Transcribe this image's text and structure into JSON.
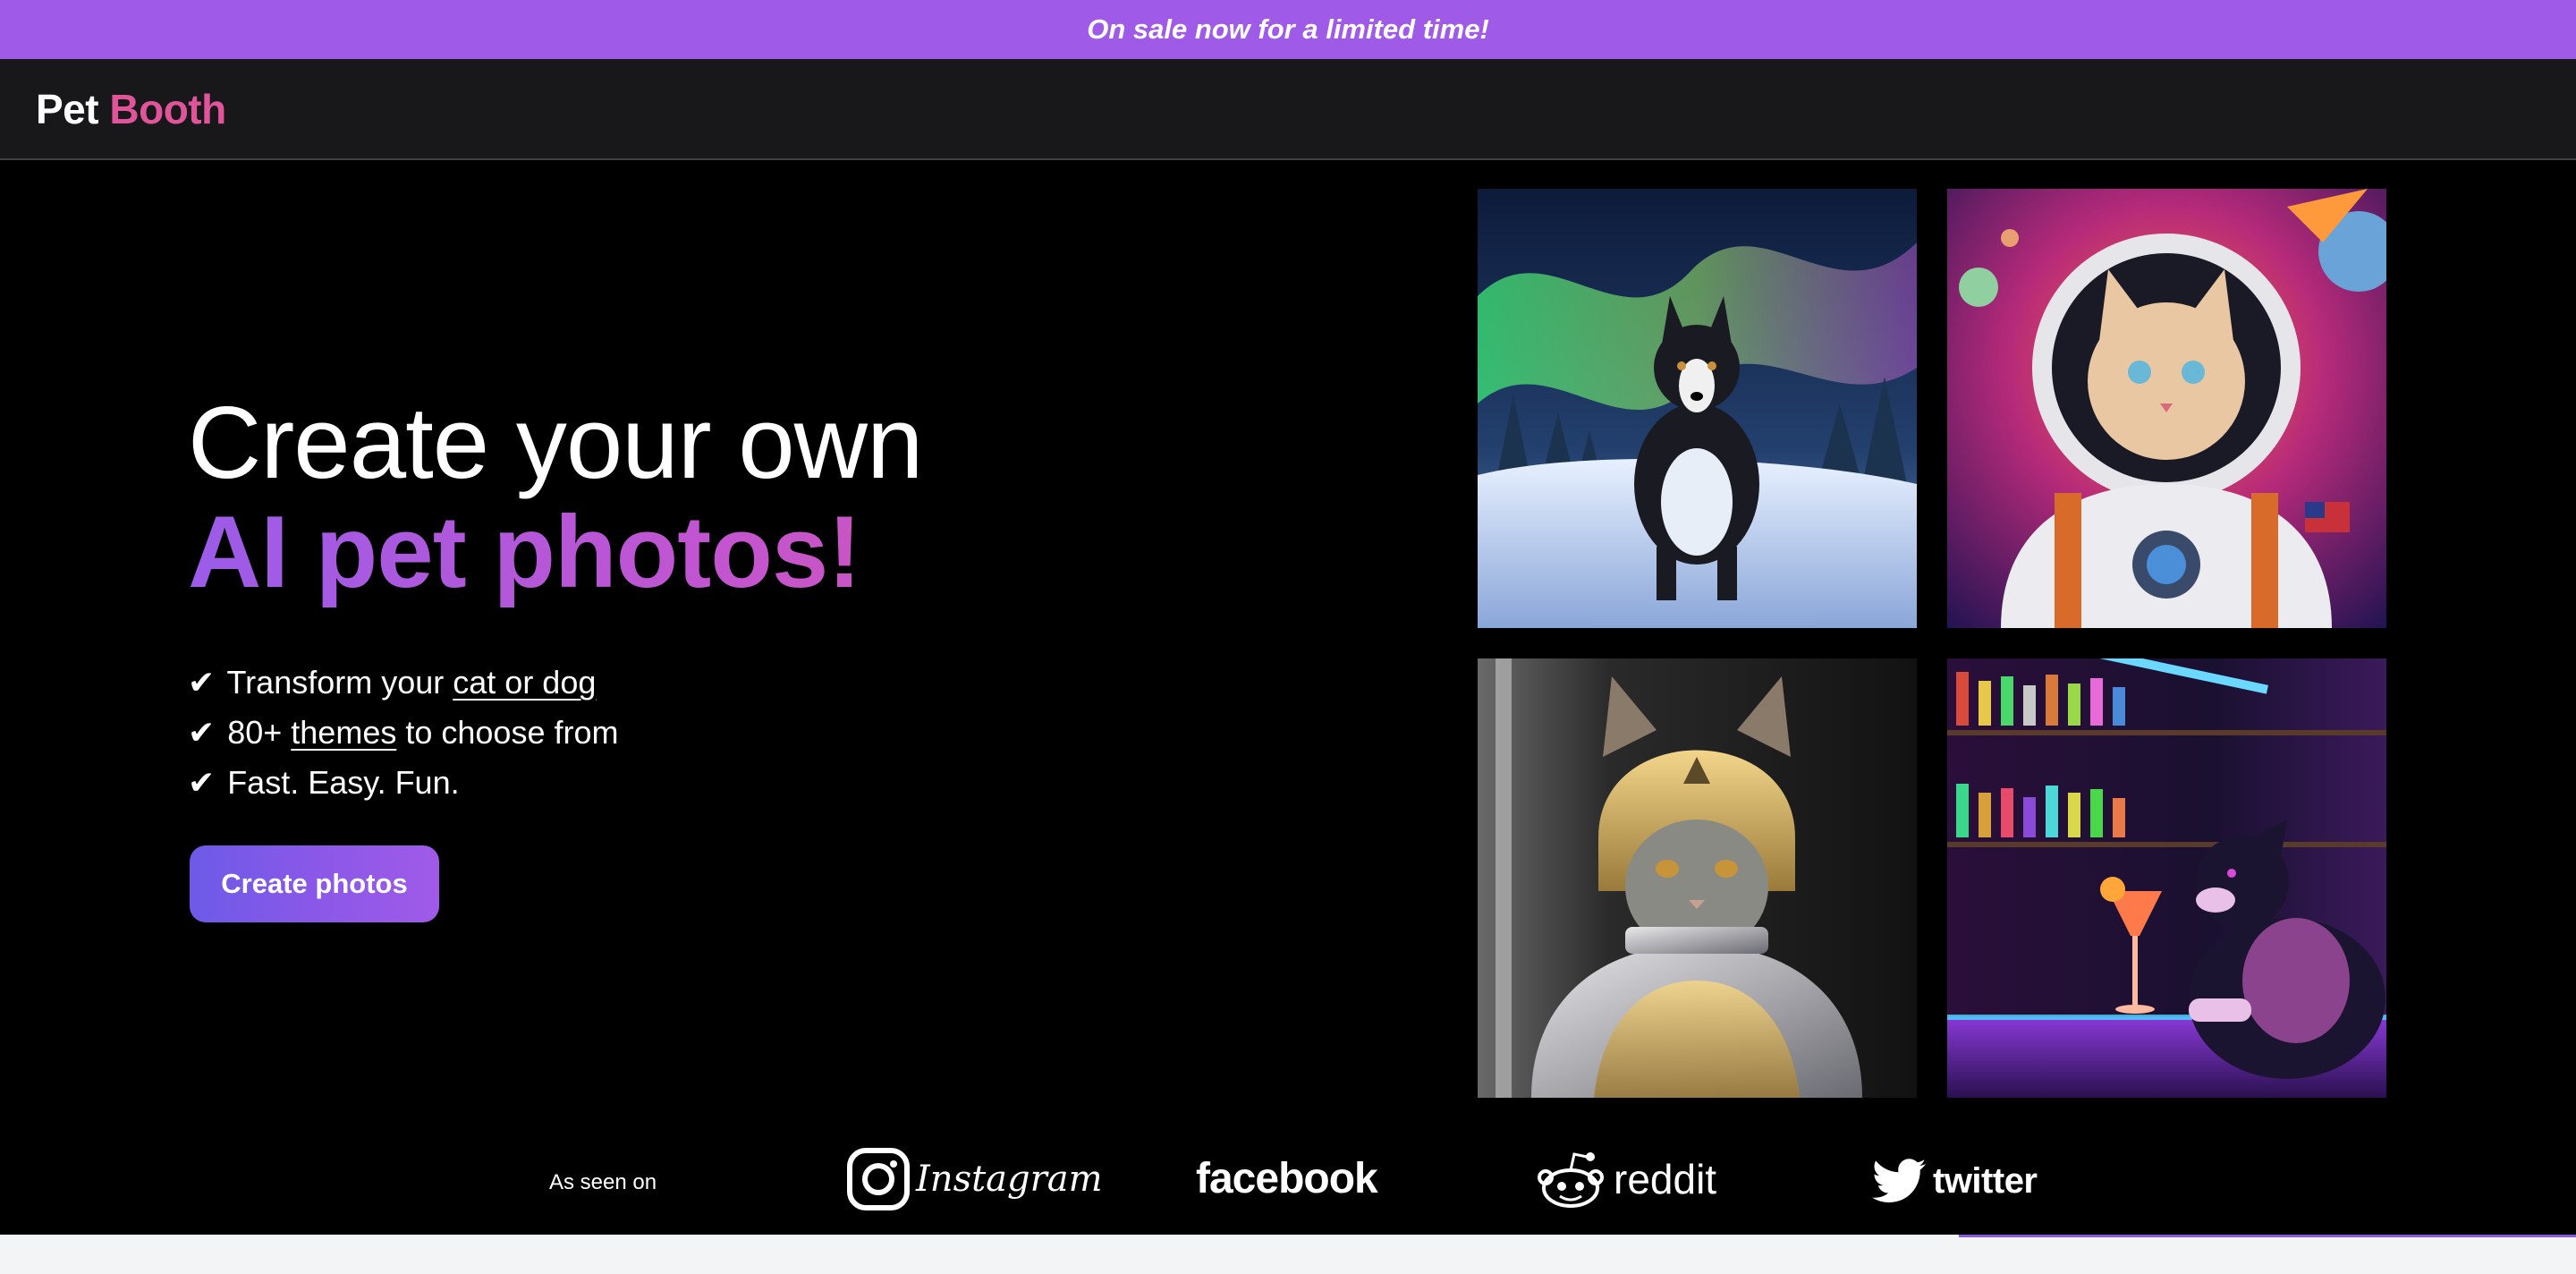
{
  "promo": {
    "text": "On sale now for a limited time!"
  },
  "nav": {
    "logo_part1": "Pet",
    "logo_part2": "Booth"
  },
  "hero": {
    "headline_line1": "Create your own",
    "headline_line2": "AI pet photos!",
    "features": [
      {
        "check": "✔",
        "before": "Transform your",
        "link": "cat or dog",
        "after": ""
      },
      {
        "check": "✔",
        "before": "80+",
        "link": "themes",
        "after": "to choose from"
      },
      {
        "check": "✔",
        "text": "Fast. Easy. Fun."
      }
    ],
    "cta_label": "Create photos"
  },
  "seen_on": {
    "label": "As seen on",
    "brands": {
      "instagram": "Instagram",
      "facebook": "facebook",
      "reddit": "reddit",
      "twitter": "twitter"
    }
  },
  "colors": {
    "promo_bg": "#a05ae8",
    "nav_bg": "#18181b",
    "logo_accent": "#e0559a",
    "gradient_start": "#9b5ce8",
    "gradient_end": "#e0559a",
    "button_start": "#6d5ae8",
    "button_end": "#a05ae8"
  }
}
